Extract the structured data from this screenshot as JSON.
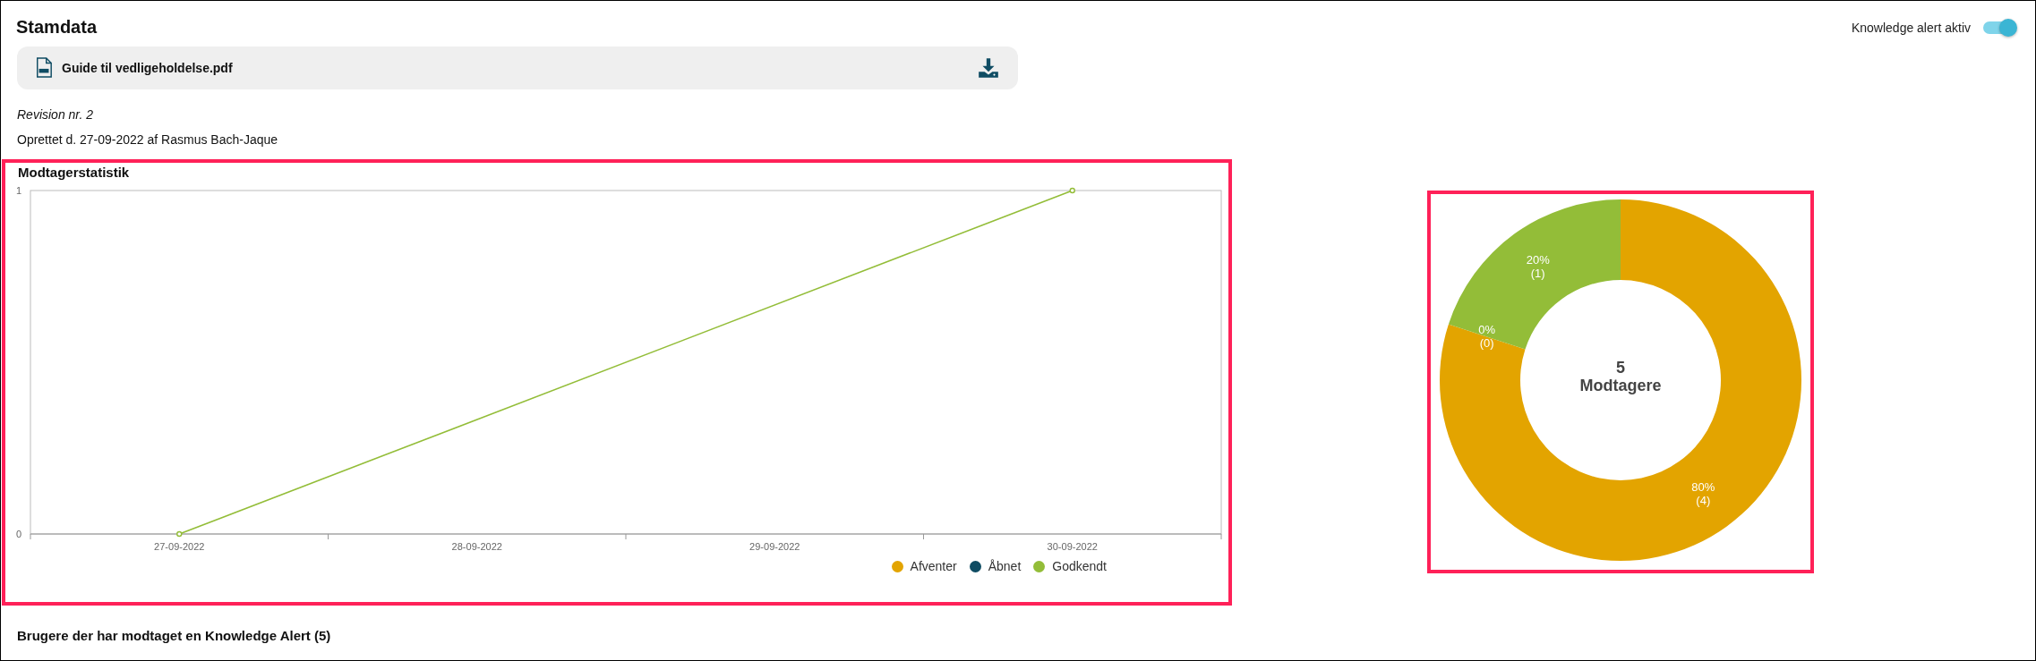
{
  "header": {
    "title": "Stamdata",
    "toggle": {
      "label": "Knowledge alert aktiv",
      "on": true
    }
  },
  "attachment": {
    "file_name": "Guide til vedligeholdelse.pdf"
  },
  "revision": "Revision nr. 2",
  "created": "Oprettet d. 27-09-2022 af Rasmus Bach-Jaque",
  "statistics": {
    "title": "Modtagerstatistik",
    "highlighted": true,
    "chart_data": {
      "type": "line",
      "categories": [
        "27-09-2022",
        "28-09-2022",
        "29-09-2022",
        "30-09-2022"
      ],
      "ylim": [
        0,
        1
      ],
      "yticks": [
        0,
        1
      ],
      "series": [
        {
          "name": "Afventer",
          "color": "#e3a400",
          "values": [
            null,
            null,
            null,
            null
          ]
        },
        {
          "name": "Åbnet",
          "color": "#0f4c63",
          "values": [
            null,
            null,
            null,
            null
          ]
        },
        {
          "name": "Godkendt",
          "color": "#93bd38",
          "marker": true,
          "values": [
            0,
            null,
            null,
            1
          ]
        }
      ]
    }
  },
  "recipients": {
    "highlighted": true,
    "chart_data": {
      "type": "donut",
      "colors": [
        "#e3a400",
        "#0f4c63",
        "#93bd38"
      ],
      "values": [
        4,
        0,
        1
      ],
      "value_labels": [
        "80% (4)",
        "0% (0)",
        "20% (1)"
      ]
    },
    "center_text": [
      "5",
      "Modtagere"
    ]
  },
  "users_heading": "Brugere der har modtaget en Knowledge Alert (5)"
}
